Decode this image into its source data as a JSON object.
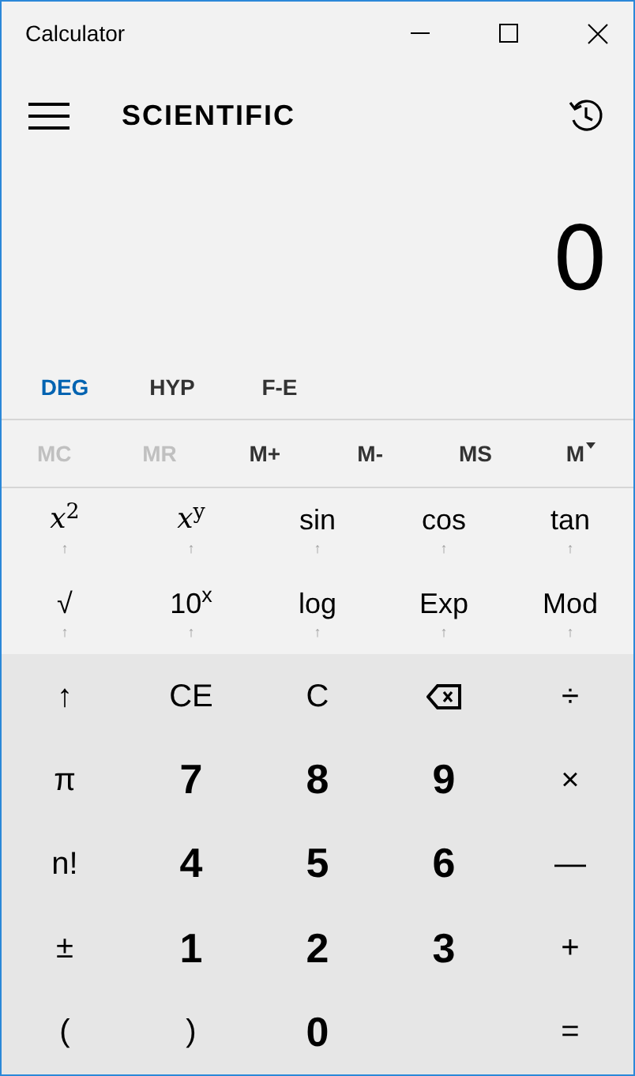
{
  "window": {
    "title": "Calculator"
  },
  "header": {
    "mode": "SCIENTIFIC"
  },
  "display": {
    "value": "0"
  },
  "mode_buttons": [
    {
      "label": "DEG",
      "highlighted": true
    },
    {
      "label": "HYP",
      "highlighted": false
    },
    {
      "label": "F-E",
      "highlighted": false
    }
  ],
  "memory_buttons": [
    {
      "label": "MC",
      "disabled": true,
      "dropdown": false
    },
    {
      "label": "MR",
      "disabled": true,
      "dropdown": false
    },
    {
      "label": "M+",
      "disabled": false,
      "dropdown": false
    },
    {
      "label": "M-",
      "disabled": false,
      "dropdown": false
    },
    {
      "label": "MS",
      "disabled": false,
      "dropdown": false
    },
    {
      "label": "M",
      "disabled": false,
      "dropdown": true
    }
  ],
  "function_keys": [
    {
      "label": "*x*$^{2}$",
      "shift_mark": "↑",
      "kind": "math"
    },
    {
      "label": "*x*$^{y}$",
      "shift_mark": "↑",
      "kind": "math"
    },
    {
      "label": "sin",
      "shift_mark": "↑",
      "kind": "text"
    },
    {
      "label": "cos",
      "shift_mark": "↑",
      "kind": "text"
    },
    {
      "label": "tan",
      "shift_mark": "↑",
      "kind": "text"
    },
    {
      "label": "√",
      "shift_mark": "↑",
      "kind": "text"
    },
    {
      "label": "10$^{x}$",
      "shift_mark": "↑",
      "kind": "text"
    },
    {
      "label": "log",
      "shift_mark": "↑",
      "kind": "text"
    },
    {
      "label": "Exp",
      "shift_mark": "↑",
      "kind": "text"
    },
    {
      "label": "Mod",
      "shift_mark": "↑",
      "kind": "text"
    }
  ],
  "keypad": [
    {
      "label": "↑",
      "kind": "op"
    },
    {
      "label": "CE",
      "kind": "op"
    },
    {
      "label": "C",
      "kind": "op"
    },
    {
      "kind": "backspace"
    },
    {
      "label": "÷",
      "kind": "op"
    },
    {
      "label": "π",
      "kind": "op"
    },
    {
      "label": "7",
      "kind": "digit"
    },
    {
      "label": "8",
      "kind": "digit"
    },
    {
      "label": "9",
      "kind": "digit"
    },
    {
      "label": "×",
      "kind": "op"
    },
    {
      "label": "n!",
      "kind": "op"
    },
    {
      "label": "4",
      "kind": "digit"
    },
    {
      "label": "5",
      "kind": "digit"
    },
    {
      "label": "6",
      "kind": "digit"
    },
    {
      "label": "—",
      "kind": "op"
    },
    {
      "label": "±",
      "kind": "op"
    },
    {
      "label": "1",
      "kind": "digit"
    },
    {
      "label": "2",
      "kind": "digit"
    },
    {
      "label": "3",
      "kind": "digit"
    },
    {
      "label": "+",
      "kind": "op"
    },
    {
      "label": "(",
      "kind": "op"
    },
    {
      "label": ")",
      "kind": "op"
    },
    {
      "label": "0",
      "kind": "digit"
    },
    {
      "label": "=",
      "kind": "op"
    }
  ]
}
